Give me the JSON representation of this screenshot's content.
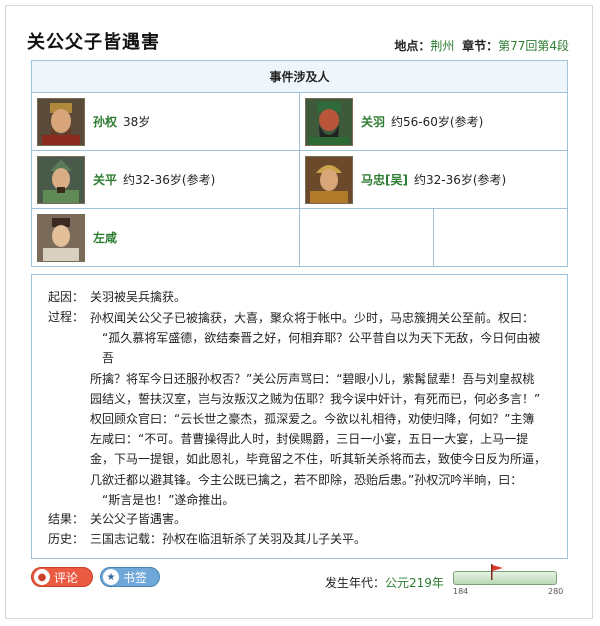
{
  "event": {
    "title": "关公父子皆遇害",
    "place_label": "地点：",
    "place": "荆州",
    "chapter_label": "章节：",
    "chapter": "第77回第4段"
  },
  "persons": {
    "header": "事件涉及人",
    "list": [
      {
        "name": "孙权",
        "age": "38岁"
      },
      {
        "name": "关羽",
        "age": "约56-60岁(参考)"
      },
      {
        "name": "关平",
        "age": "约32-36岁(参考)"
      },
      {
        "name": "马忠[吴]",
        "age": "约32-36岁(参考)"
      },
      {
        "name": "左咸",
        "age": ""
      }
    ]
  },
  "details": {
    "cause_label": "起因：",
    "cause": "关羽被吴兵擒获。",
    "process_label": "过程：",
    "process_lines": [
      "孙权闻关公父子已被擒获，大喜，聚众将于帐中。少时，马忠簇拥关公至前。权曰：",
      "“孤久慕将军盛德，欲结秦晋之好，何相弃耶？公平昔自以为天下无敌，今日何由被吾",
      "所擒？将军今日还服孙权否？”关公厉声骂曰：“碧眼小儿，紫髯鼠辈！吾与刘皇叔桃",
      "园结义，誓扶汉室，岂与汝叛汉之贼为伍耶？我今误中奸计，有死而已，何必多言！”",
      "权回顾众官曰：“云长世之豪杰，孤深爱之。今欲以礼相待，劝使归降，何如？”主簿",
      "左咸曰：“不可。昔曹操得此人时，封侯赐爵，三日一小宴，五日一大宴，上马一提",
      "金，下马一提银，如此恩礼，毕竟留之不住，听其斩关杀将而去，致使今日反为所逼，",
      "几欲迁都以避其锋。今主公既已擒之，若不即除，恐贻后患。”孙权沉吟半晌，曰：",
      "“斯言是也！”遂命推出。"
    ],
    "result_label": "结果：",
    "result": "关公父子皆遇害。",
    "history_label": "历史：",
    "history": "三国志记载：孙权在临沮斩杀了关羽及其儿子关平。"
  },
  "actions": {
    "comment_label": "评论",
    "bookmark_label": "书签"
  },
  "timeline": {
    "label": "发生年代：",
    "value": "公元219年",
    "min": "184",
    "max": "280",
    "current_year": 219
  },
  "colors": {
    "accent_green": "#2e7d32",
    "border_blue": "#9fc3dc",
    "comment_red": "#e95a40",
    "bookmark_blue": "#6fa8d8"
  }
}
